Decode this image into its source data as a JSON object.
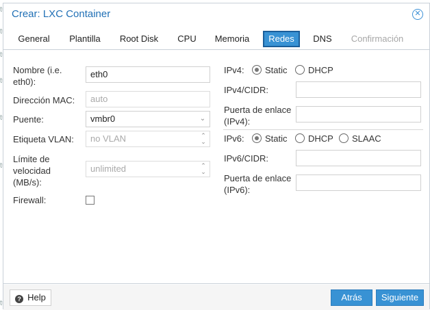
{
  "background": {
    "fragments": [
      "tu",
      "tu",
      "tu",
      "tu",
      "tu",
      "tu",
      "tu"
    ]
  },
  "window": {
    "title": "Crear: LXC Container",
    "close_icon": "close-icon"
  },
  "tabs": [
    {
      "label": "General"
    },
    {
      "label": "Plantilla"
    },
    {
      "label": "Root Disk"
    },
    {
      "label": "CPU"
    },
    {
      "label": "Memoria"
    },
    {
      "label": "Redes",
      "active": true
    },
    {
      "label": "DNS"
    },
    {
      "label": "Confirmación",
      "disabled": true
    }
  ],
  "left": {
    "name_label": "Nombre (i.e. eth0):",
    "name_value": "eth0",
    "mac_label": "Dirección MAC:",
    "mac_placeholder": "auto",
    "bridge_label": "Puente:",
    "bridge_value": "vmbr0",
    "vlan_label": "Etiqueta VLAN:",
    "vlan_placeholder": "no VLAN",
    "rate_label": "Límite de velocidad (MB/s):",
    "rate_placeholder": "unlimited",
    "firewall_label": "Firewall:",
    "firewall_checked": false
  },
  "right": {
    "ipv4_label": "IPv4:",
    "ipv4_options": [
      "Static",
      "DHCP"
    ],
    "ipv4_selected": "Static",
    "ipv4_cidr_label": "IPv4/CIDR:",
    "ipv4_cidr_value": "",
    "gw4_label": "Puerta de enlace (IPv4):",
    "gw4_value": "",
    "ipv6_label": "IPv6:",
    "ipv6_options": [
      "Static",
      "DHCP",
      "SLAAC"
    ],
    "ipv6_selected": "Static",
    "ipv6_cidr_label": "IPv6/CIDR:",
    "ipv6_cidr_value": "",
    "gw6_label": "Puerta de enlace (IPv6):",
    "gw6_value": ""
  },
  "footer": {
    "help_label": "Help",
    "back_label": "Atrás",
    "next_label": "Siguiente"
  },
  "colors": {
    "accent": "#3892d4",
    "title": "#1f6fb5"
  }
}
